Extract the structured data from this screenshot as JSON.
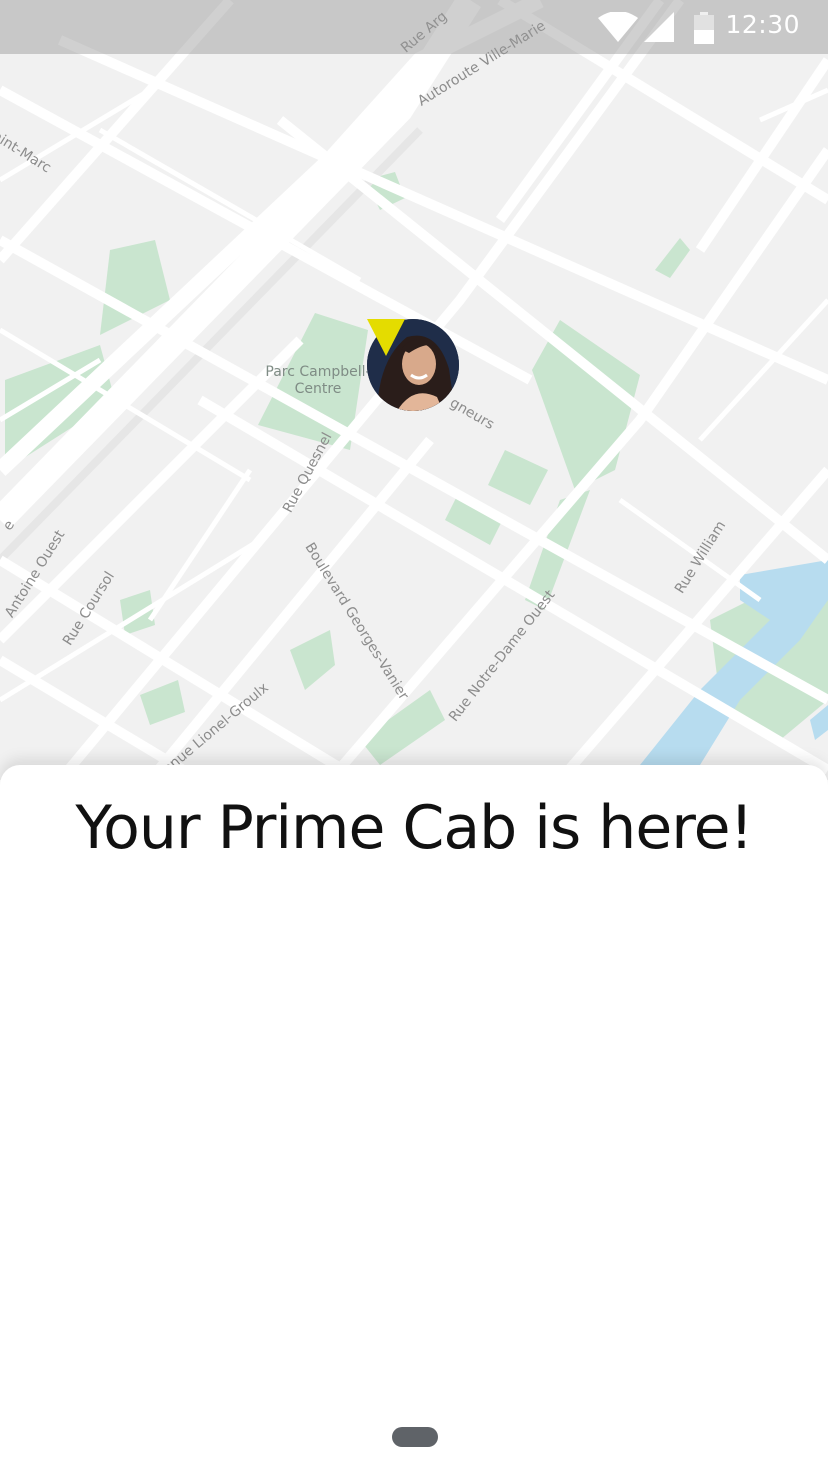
{
  "status_bar": {
    "time": "12:30",
    "icons": [
      "wifi-icon",
      "cellular-signal-icon",
      "battery-icon"
    ]
  },
  "map": {
    "street_labels": [
      "Rue Arg",
      "Autoroute Ville-Marie",
      "aint-Marc",
      "Rue Quesnel",
      "gneurs",
      "Boulevard Georges-Vanier",
      "Rue Notre-Dame Ouest",
      "Rue William",
      "Antoine Ouest",
      "Rue Coursol",
      "enue Lionel-Groulx",
      "e"
    ],
    "park_label": "Parc Campbell-Centre",
    "colors": {
      "background": "#f1f1f1",
      "road": "#ffffff",
      "park": "#c9e5cf",
      "water": "#b7dcef"
    }
  },
  "driver_pin": {
    "icon": "driver-avatar-pin",
    "pin_color": "#e4dc00"
  },
  "sheet": {
    "title": "Your Prime Cab is here!"
  },
  "home_handle": {
    "icon": "home-handle-icon"
  }
}
